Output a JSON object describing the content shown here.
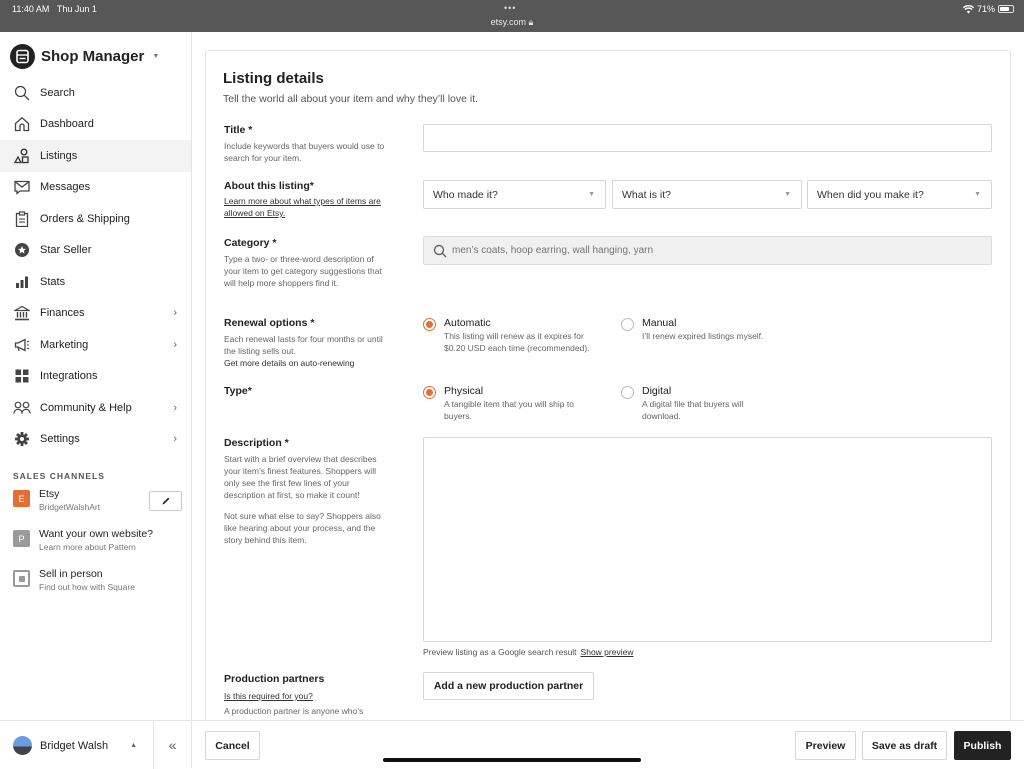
{
  "statusbar": {
    "time": "11:40 AM",
    "date": "Thu Jun 1",
    "url": "etsy.com",
    "battery_pct": "71%",
    "battery_level": 0.71
  },
  "sidebar": {
    "brand": "Shop Manager",
    "items": [
      {
        "label": "Search",
        "icon": "search-icon"
      },
      {
        "label": "Dashboard",
        "icon": "home-icon"
      },
      {
        "label": "Listings",
        "icon": "shapes-icon",
        "active": true
      },
      {
        "label": "Messages",
        "icon": "envelope-icon"
      },
      {
        "label": "Orders & Shipping",
        "icon": "clipboard-icon"
      },
      {
        "label": "Star Seller",
        "icon": "star-badge-icon"
      },
      {
        "label": "Stats",
        "icon": "bar-chart-icon"
      },
      {
        "label": "Finances",
        "icon": "bank-icon",
        "chevron": true
      },
      {
        "label": "Marketing",
        "icon": "megaphone-icon",
        "chevron": true
      },
      {
        "label": "Integrations",
        "icon": "grid-icon"
      },
      {
        "label": "Community & Help",
        "icon": "people-icon",
        "chevron": true
      },
      {
        "label": "Settings",
        "icon": "gear-icon",
        "chevron": true
      }
    ],
    "sales_channels_title": "SALES CHANNELS",
    "channels": [
      {
        "badge": "E",
        "name": "Etsy",
        "sub": "BridgetWalshArt",
        "color": "#e56e35"
      },
      {
        "badge": "P",
        "name": "Want your own website?",
        "sub": "Learn more about Pattern",
        "color": "#9a9a9a"
      },
      {
        "badge": "",
        "name": "Sell in person",
        "sub": "Find out how with Square",
        "color": "#9a9a9a"
      }
    ],
    "user_name": "Bridget Walsh",
    "collapse_glyph": "«"
  },
  "main": {
    "title": "Listing details",
    "subtitle": "Tell the world all about your item and why they’ll love it.",
    "title_field": {
      "label": "Title *",
      "desc": "Include keywords that buyers would use to search for your item.",
      "value": ""
    },
    "about": {
      "label": "About this listing*",
      "link": "Learn more about what types of items are allowed on Etsy.",
      "selects": [
        "Who made it?",
        "What is it?",
        "When did you make it?"
      ]
    },
    "category": {
      "label": "Category *",
      "desc": "Type a two- or three-word description of your item to get category suggestions that will help more shoppers find it.",
      "placeholder": "men’s coats, hoop earring, wall hanging, yarn"
    },
    "renewal": {
      "label": "Renewal options *",
      "desc": "Each renewal lasts for four months or until the listing sells out.",
      "link": "Get more details on auto-renewing",
      "options": [
        {
          "title": "Automatic",
          "desc": "This listing will renew as it expires for $0.20 USD each time (recommended).",
          "selected": true
        },
        {
          "title": "Manual",
          "desc": "I’ll renew expired listings myself.",
          "selected": false
        }
      ]
    },
    "type": {
      "label": "Type*",
      "options": [
        {
          "title": "Physical",
          "desc": "A tangible item that you will ship to buyers.",
          "selected": true
        },
        {
          "title": "Digital",
          "desc": "A digital file that buyers will download.",
          "selected": false
        }
      ]
    },
    "description": {
      "label": "Description *",
      "desc1": "Start with a brief overview that describes your item’s finest features. Shoppers will only see the first few lines of your description at first, so make it count!",
      "desc2": "Not sure what else to say? Shoppers also like hearing about your process, and the story behind this item.",
      "value": ""
    },
    "preview_note": "Preview listing as a Google search result",
    "show_preview": "Show preview",
    "production": {
      "label": "Production partners",
      "link": "Is this required for you?",
      "desc": "A production partner is anyone who’s",
      "button": "Add a new production partner"
    }
  },
  "bottombar": {
    "cancel": "Cancel",
    "preview": "Preview",
    "save_draft": "Save as draft",
    "publish": "Publish"
  }
}
